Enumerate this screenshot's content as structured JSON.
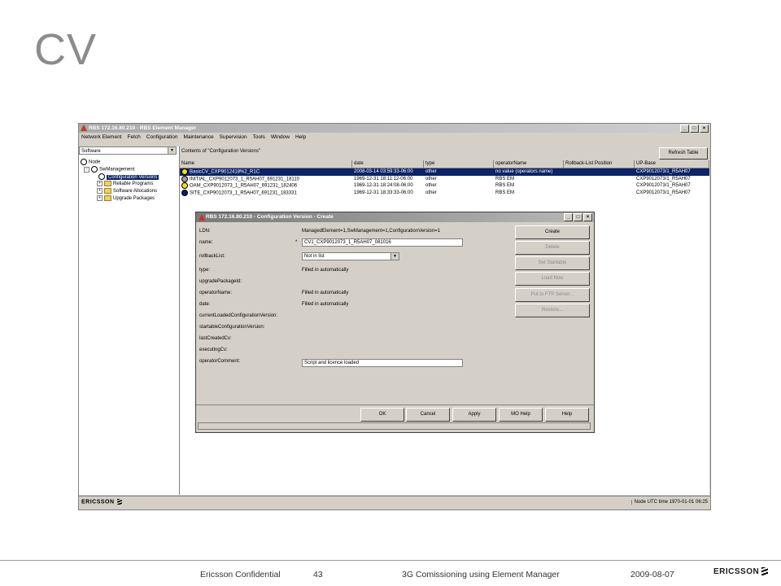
{
  "slide": {
    "title": "CV"
  },
  "main_window": {
    "title": "RBS 172.16.80.210 - RBS Element Manager",
    "menu": [
      "Network Element",
      "Fetch",
      "Configuration",
      "Maintenance",
      "Supervision",
      "Tools",
      "Window",
      "Help"
    ],
    "tree_selector": "Software",
    "tree": {
      "node": "Node",
      "sw_management": "SwManagement",
      "configuration_versions": "Configuration Versions",
      "reliable_programs": "Reliable Programs",
      "software_allocations": "Software Allocations",
      "upgrade_packages": "Upgrade Packages"
    },
    "contents_label": "Contents of \"Configuration Versions\"",
    "refresh_label": "Refresh Table",
    "table": {
      "columns": [
        "Name",
        "date",
        "type",
        "operatorName",
        "Rollback-List Position",
        "UP-Base"
      ],
      "rows": [
        [
          "BasicCV_CXP9012418%2_R1C",
          "2008-03-14 03:59:33-06:00",
          "other",
          "no value (operators name)",
          "",
          "CXP9012073/1_R5AH07"
        ],
        [
          "INITIAL_CXP9012073_1_R5AH07_691231_18110",
          "1969-12-31 18:11:12-06:00",
          "other",
          "RBS EM",
          "",
          "CXP9012073/1_R5AH07"
        ],
        [
          "OAM_CXP9012073_1_R5AH07_691231_182406",
          "1969-12-31 18:24:08-06:00",
          "other",
          "RBS EM",
          "",
          "CXP9012073/1_R5AH07"
        ],
        [
          "SITE_CXP9012073_1_R5AH07_691231_183331",
          "1969-12-31 18:33:33-06:00",
          "other",
          "RBS EM",
          "",
          "CXP9012073/1_R5AH07"
        ]
      ],
      "row_icon_colors": [
        "#f5e400",
        "#9a9aa8",
        "#f5e400",
        "#0a1a7a"
      ]
    },
    "status": {
      "brand": "ERICSSON",
      "time": "Node UTC time 1970-01-01 06:25"
    }
  },
  "dialog": {
    "title": "RBS 172.16.80.210 - Configuration Version - Create",
    "fields": {
      "ldn_label": "LDN:",
      "ldn_value": "ManagedElement=1,SwManagement=1,ConfigurationVersion=1",
      "name_label": "name:",
      "name_required": "*",
      "name_value": "CV1_CXP9012073_1_R5AH07_081016",
      "rollback_label": "rollbackList:",
      "rollback_value": "Not in list",
      "type_label": "type:",
      "type_value": "Filled in automatically",
      "upgrade_label": "upgradePackageId:",
      "operatorname_label": "operatorName:",
      "operatorname_value": "Filled in automatically",
      "date_label": "date:",
      "date_value": "Filled in automatically",
      "current_label": "currentLoadedConfigurationVersion:",
      "startable_label": "startableConfigurationVersion:",
      "lastcreated_label": "lastCreatedCv:",
      "executing_label": "executingCv:",
      "comment_label": "operatorComment:",
      "comment_value": "Script and licence loaded"
    },
    "side_buttons": {
      "create": "Create",
      "delete": "Delete",
      "set_startable": "Set Startable",
      "load_now": "Load Now",
      "put_ftp": "Put to FTP Server...",
      "restore": "Restore..."
    },
    "bottom_buttons": {
      "ok": "OK",
      "cancel": "Cancel",
      "apply": "Apply",
      "mo_help": "MO Help",
      "help": "Help"
    }
  },
  "footer": {
    "confidential": "Ericsson Confidential",
    "page": "43",
    "doc_title": "3G Comissioning using Element Manager",
    "date": "2009-08-07",
    "logo": "ERICSSON"
  }
}
